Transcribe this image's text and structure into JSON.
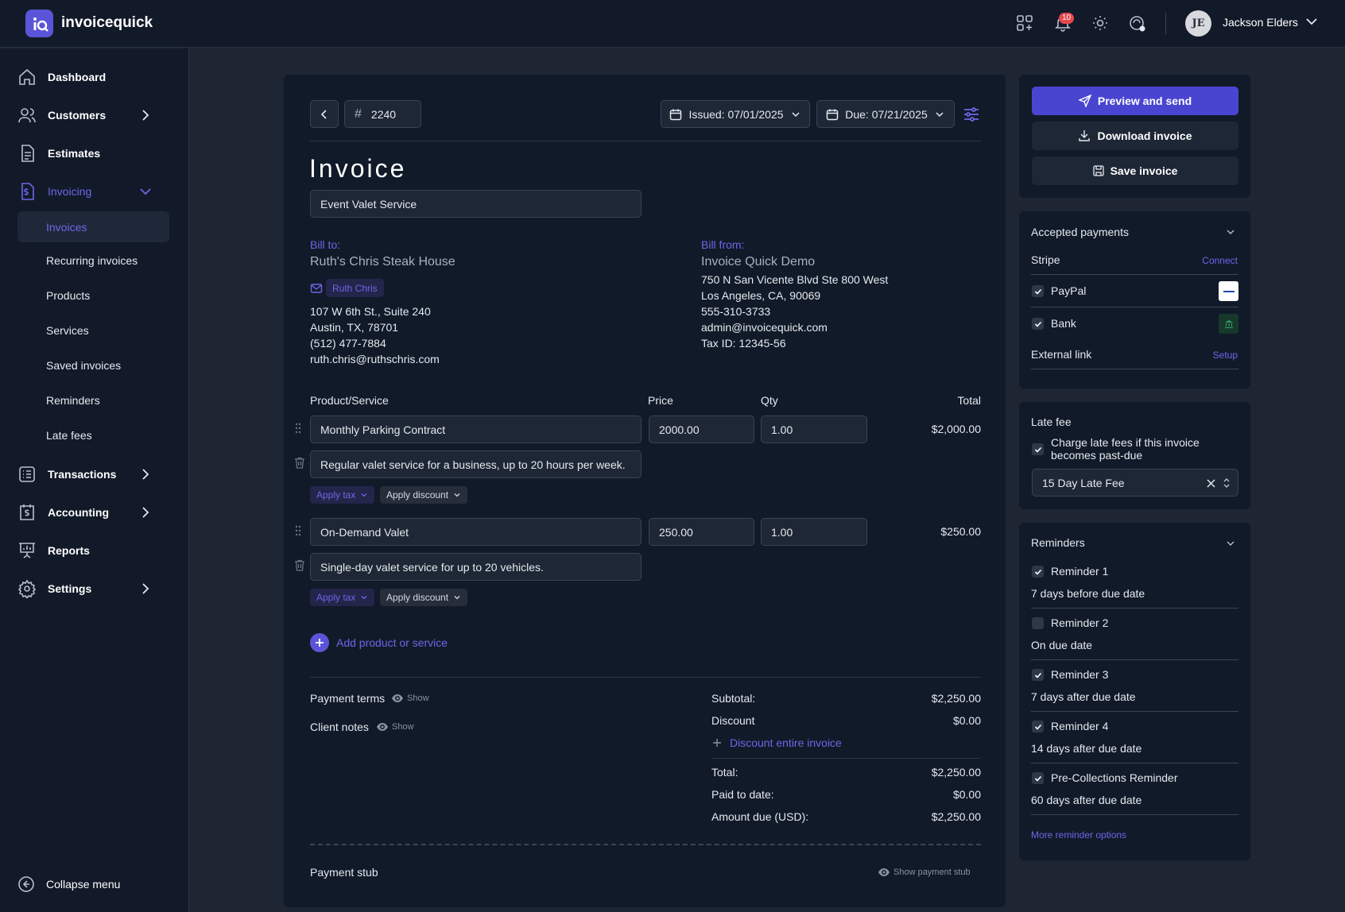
{
  "app": {
    "brand": "invoicequick",
    "notification_count": "10",
    "user_initials": "JE",
    "user_name": "Jackson Elders"
  },
  "sidebar": {
    "dashboard": "Dashboard",
    "customers": "Customers",
    "estimates": "Estimates",
    "invoicing": "Invoicing",
    "sub": {
      "invoices": "Invoices",
      "recurring": "Recurring invoices",
      "products": "Products",
      "services": "Services",
      "saved": "Saved invoices",
      "reminders": "Reminders",
      "late_fees": "Late fees"
    },
    "transactions": "Transactions",
    "accounting": "Accounting",
    "reports": "Reports",
    "settings": "Settings",
    "collapse": "Collapse menu"
  },
  "invoice": {
    "number": "2240",
    "issued": "Issued: 07/01/2025",
    "due": "Due: 07/21/2025",
    "title": "Invoice",
    "subject": "Event Valet Service",
    "bill_to": {
      "label": "Bill to:",
      "name": "Ruth's Chris Steak House",
      "contact": "Ruth Chris",
      "line1": "107 W 6th St., Suite 240",
      "line2": "Austin, TX, 78701",
      "phone": "(512) 477-7884",
      "email": "ruth.chris@ruthschris.com"
    },
    "bill_from": {
      "label": "Bill from:",
      "name": "Invoice Quick Demo",
      "line1": "750 N San Vicente Blvd Ste 800 West",
      "line2": "Los Angeles, CA, 90069",
      "phone": "555-310-3733",
      "email": "admin@invoicequick.com",
      "tax": "Tax ID: 12345-56"
    },
    "columns": {
      "product": "Product/Service",
      "price": "Price",
      "qty": "Qty",
      "total": "Total"
    },
    "items": [
      {
        "name": "Monthly Parking Contract",
        "price": "2000.00",
        "qty": "1.00",
        "total": "$2,000.00",
        "desc": "Regular valet service for a business, up to 20 hours per week.",
        "tax": "Apply tax",
        "discount": "Apply discount"
      },
      {
        "name": "On-Demand Valet",
        "price": "250.00",
        "qty": "1.00",
        "total": "$250.00",
        "desc": "Single-day valet service for up to 20 vehicles.",
        "tax": "Apply tax",
        "discount": "Apply discount"
      }
    ],
    "add_item": "Add product or service",
    "payment_terms": "Payment terms",
    "client_notes": "Client notes",
    "show": "Show",
    "totals": {
      "subtotal_label": "Subtotal:",
      "subtotal": "$2,250.00",
      "discount_label": "Discount",
      "discount": "$0.00",
      "discount_link": "Discount entire invoice",
      "total_label": "Total:",
      "total": "$2,250.00",
      "paid_label": "Paid to date:",
      "paid": "$0.00",
      "due_label": "Amount due (USD):",
      "due": "$2,250.00"
    },
    "payment_stub": "Payment stub",
    "show_stub": "Show payment stub"
  },
  "actions": {
    "preview": "Preview and send",
    "download": "Download invoice",
    "save": "Save invoice"
  },
  "payments": {
    "title": "Accepted payments",
    "stripe": "Stripe",
    "connect": "Connect",
    "paypal": "PayPal",
    "bank": "Bank",
    "external": "External link",
    "setup": "Setup"
  },
  "late_fee": {
    "title": "Late fee",
    "charge": "Charge late fees if this invoice",
    "charge2": "becomes past-due",
    "selected": "15 Day Late Fee"
  },
  "reminders": {
    "title": "Reminders",
    "items": [
      {
        "name": "Reminder 1",
        "when": "7 days before due date",
        "checked": true
      },
      {
        "name": "Reminder 2",
        "when": "On due date",
        "checked": false
      },
      {
        "name": "Reminder 3",
        "when": "7 days after due date",
        "checked": true
      },
      {
        "name": "Reminder 4",
        "when": "14 days after due date",
        "checked": true
      },
      {
        "name": "Pre-Collections Reminder",
        "when": "60 days after due date",
        "checked": true
      }
    ],
    "more": "More reminder options"
  },
  "colors": {
    "accent": "#5a55d8",
    "bg": "#1e2533",
    "panel": "#111a29"
  }
}
